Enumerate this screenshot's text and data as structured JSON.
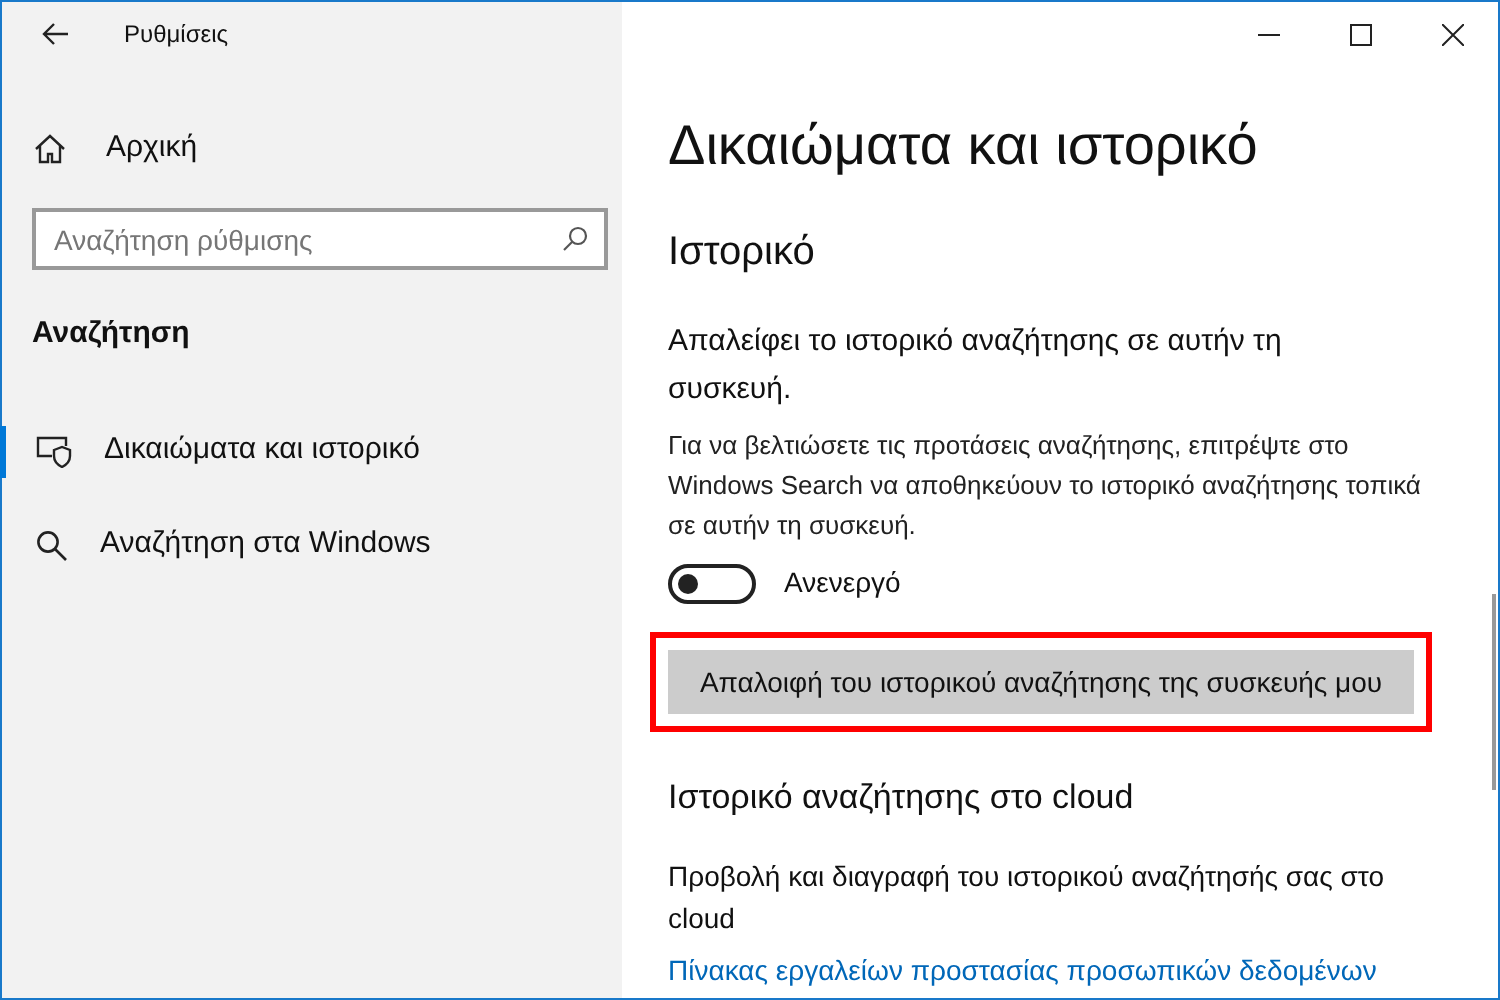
{
  "window": {
    "title": "Ρυθμίσεις"
  },
  "sidebar": {
    "home": "Αρχική",
    "search": {
      "placeholder": "Αναζήτηση ρύθμισης"
    },
    "section": "Αναζήτηση",
    "items": [
      {
        "label": "Δικαιώματα και ιστορικό",
        "kind": "privacy",
        "selected": true
      },
      {
        "label": "Αναζήτηση στα Windows",
        "kind": "search",
        "selected": false
      }
    ]
  },
  "page": {
    "title": "Δικαιώματα και ιστορικό",
    "history": {
      "heading": "Ιστορικό",
      "description": "Απαλείφει το ιστορικό αναζήτησης σε αυτήν τη συσκευή.",
      "hint": "Για να βελτιώσετε τις προτάσεις αναζήτησης, επιτρέψτε στο Windows Search να αποθηκεύουν το ιστορικό αναζήτησης τοπικά σε αυτήν τη συσκευή.",
      "toggle": {
        "on": false,
        "label": "Ανενεργό"
      },
      "button": {
        "label": "Απαλοιφή του ιστορικού αναζήτησης της συσκευής μου",
        "highlighted": true
      }
    },
    "cloud": {
      "heading": "Ιστορικό αναζήτησης στο cloud",
      "description": "Προβολή και διαγραφή του ιστορικού αναζήτησής σας στο cloud",
      "link": "Πίνακας εργαλείων προστασίας προσωπικών δεδομένων"
    }
  }
}
